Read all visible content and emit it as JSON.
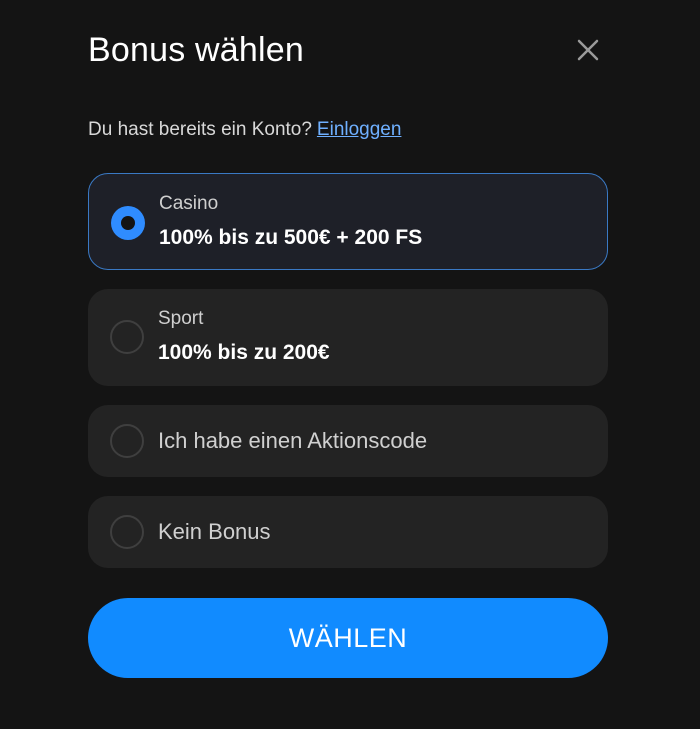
{
  "modal": {
    "title": "Bonus wählen",
    "close_icon": "close-icon"
  },
  "login": {
    "prompt": "Du hast bereits ein Konto?",
    "link": "Einloggen",
    "link_color": "#6fb0ff"
  },
  "options": [
    {
      "label": "Casino",
      "value": "100% bis zu 500€ + 200 FS",
      "selected": true
    },
    {
      "label": "Sport",
      "value": "100% bis zu 200€",
      "selected": false
    },
    {
      "label": "Ich habe einen Aktionscode",
      "selected": false
    },
    {
      "label": "Kein Bonus",
      "selected": false
    }
  ],
  "submit": {
    "label": "WÄHLEN",
    "color": "#118bff"
  },
  "colors": {
    "background": "#141414",
    "card": "#232323",
    "selected_border": "#3a79c4",
    "accent": "#2f8cff"
  }
}
